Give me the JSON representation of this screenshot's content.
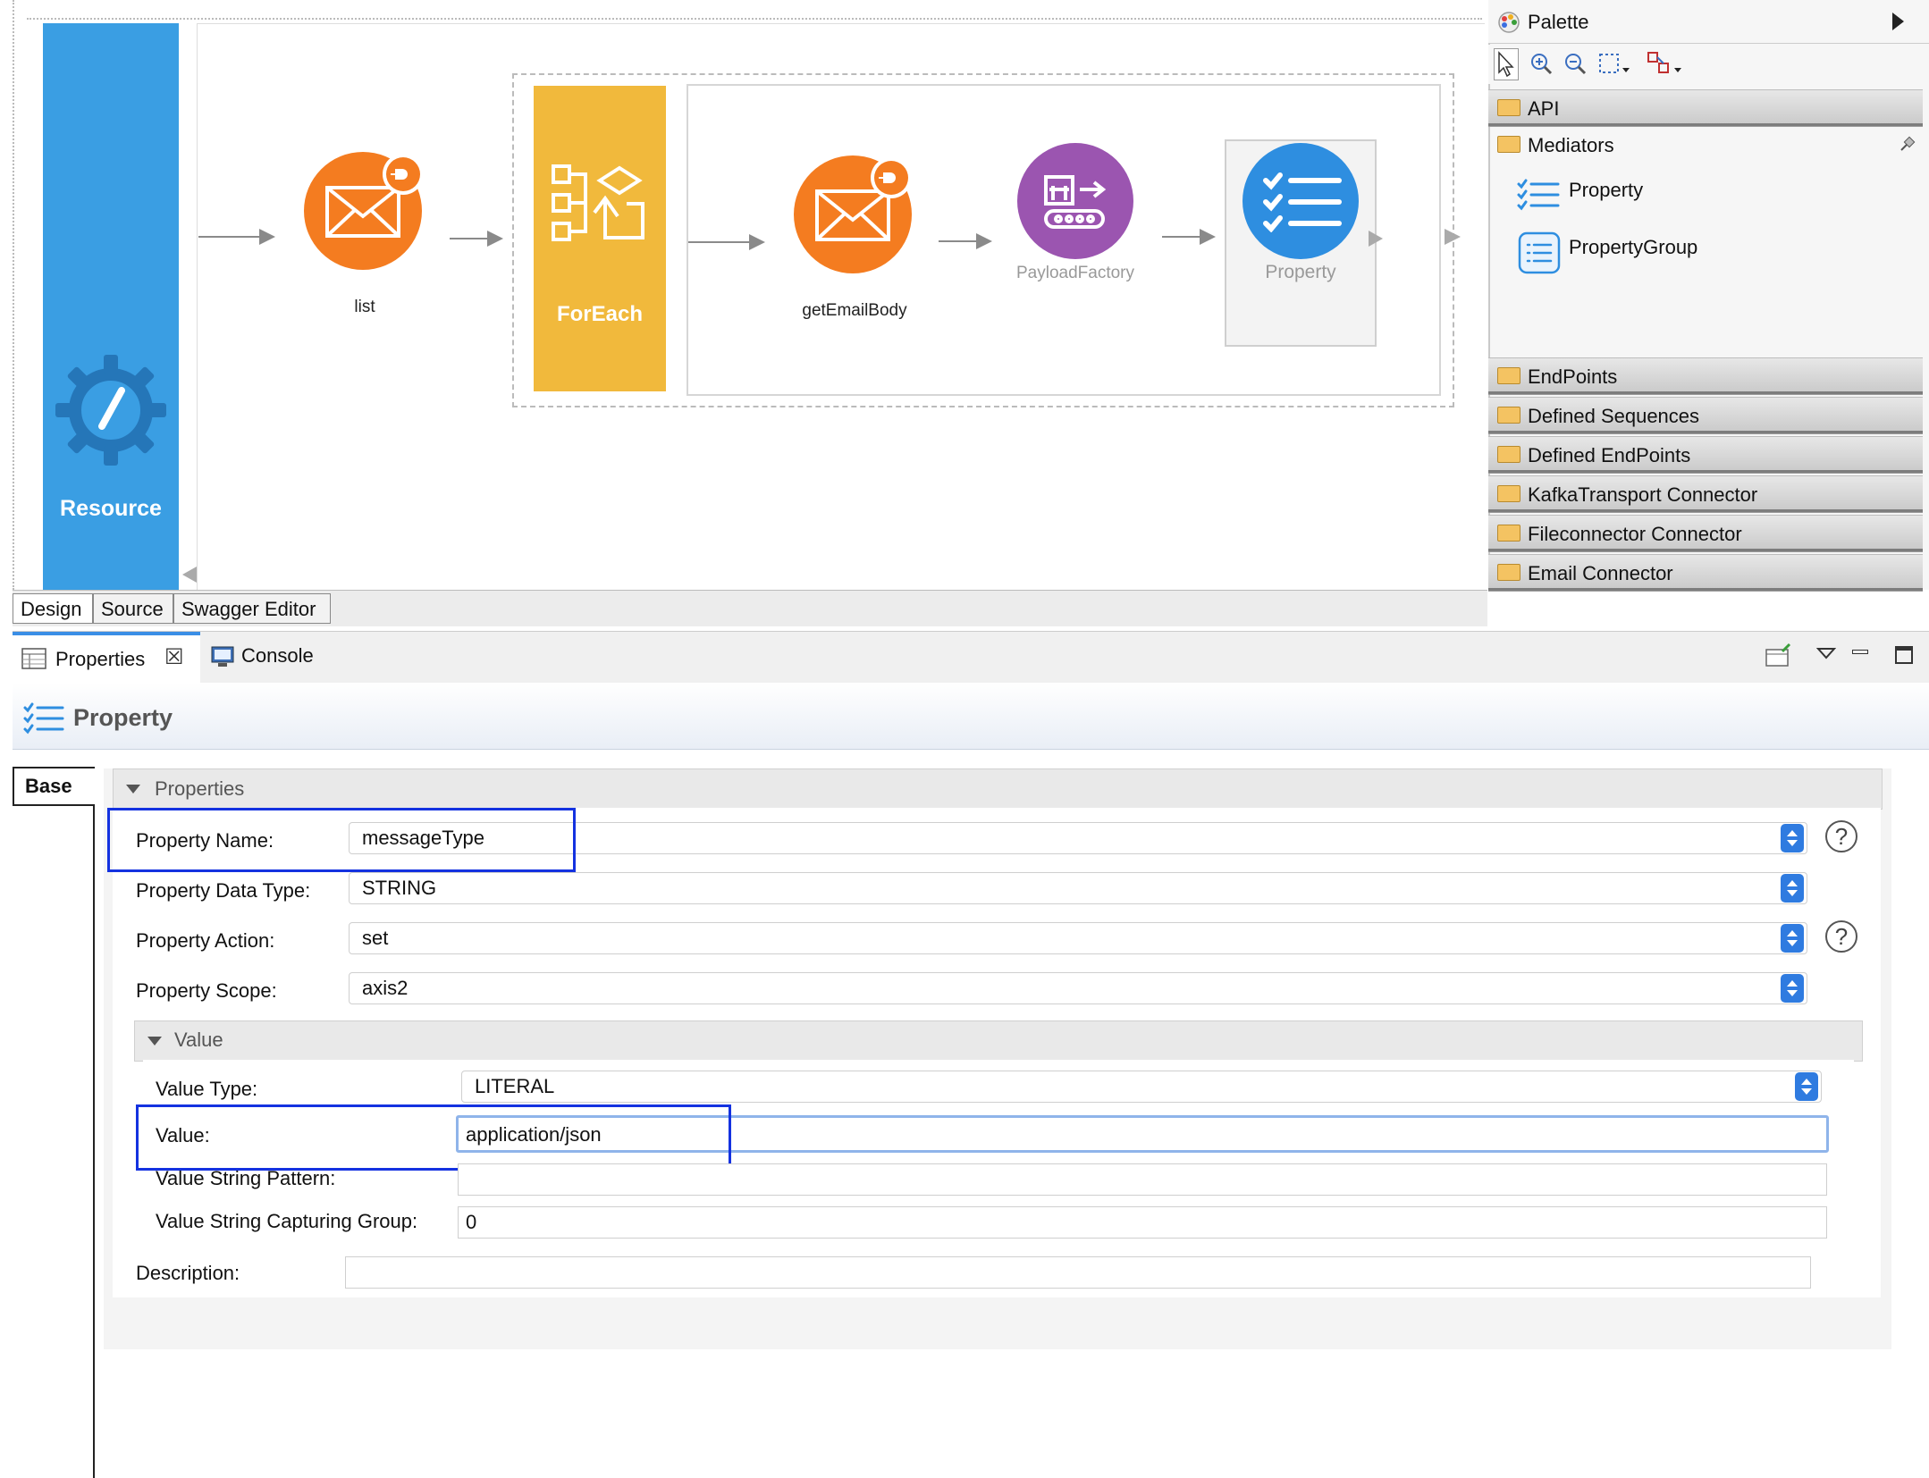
{
  "editor": {
    "resource_label": "Resource",
    "nodes": {
      "list": "list",
      "foreach": "ForEach",
      "get_email_body": "getEmailBody",
      "payload_factory": "PayloadFactory",
      "property": "Property"
    },
    "tabs": [
      "Design",
      "Source",
      "Swagger Editor"
    ]
  },
  "palette": {
    "title": "Palette",
    "groups": {
      "api": "API",
      "mediators": "Mediators",
      "endpoints": "EndPoints",
      "defined_sequences": "Defined Sequences",
      "defined_endpoints": "Defined EndPoints",
      "kafka": "KafkaTransport Connector",
      "fileconnector": "Fileconnector Connector",
      "email": "Email Connector"
    },
    "mediator_items": [
      "Property",
      "PropertyGroup"
    ]
  },
  "views": {
    "tabs": [
      "Properties",
      "Console"
    ]
  },
  "properties": {
    "title": "Property",
    "side_tab": "Base",
    "section_label": "Properties",
    "fields": {
      "property_name": {
        "label": "Property Name:",
        "value": "messageType"
      },
      "property_data_type": {
        "label": "Property Data Type:",
        "value": "STRING"
      },
      "property_action": {
        "label": "Property Action:",
        "value": "set"
      },
      "property_scope": {
        "label": "Property Scope:",
        "value": "axis2"
      }
    },
    "value_section": {
      "label": "Value",
      "value_type": {
        "label": "Value Type:",
        "value": "LITERAL"
      },
      "value": {
        "label": "Value:",
        "value": "application/json"
      },
      "value_string_pattern": {
        "label": "Value String Pattern:",
        "value": ""
      },
      "value_string_capturing_group": {
        "label": "Value String Capturing Group:",
        "value": "0"
      }
    },
    "description": {
      "label": "Description:",
      "value": ""
    }
  },
  "colors": {
    "resource_blue": "#3a9ee3",
    "foreach_yellow": "#f1b93c",
    "email_orange": "#f47c20",
    "payload_purple": "#9b55b0",
    "property_blue": "#2e8ee0",
    "highlight_blue": "#1432e0"
  }
}
